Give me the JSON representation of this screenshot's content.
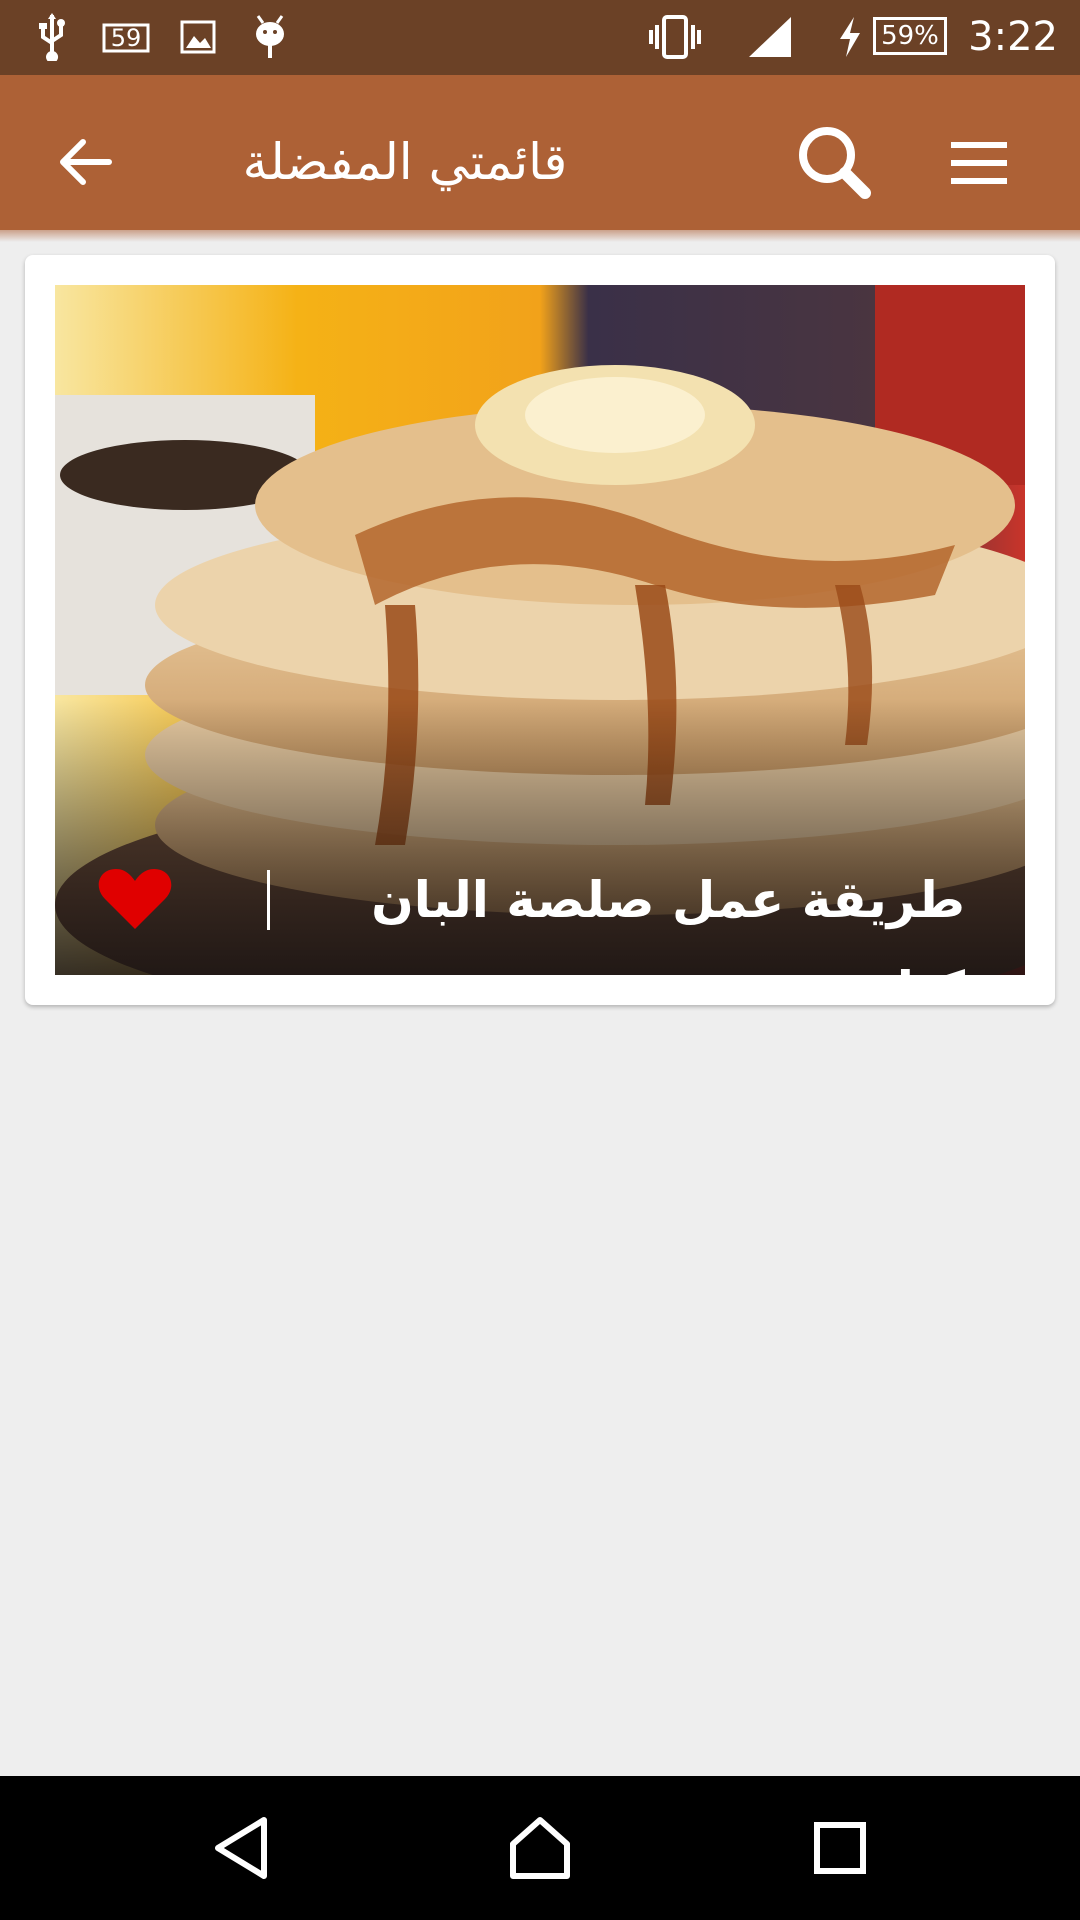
{
  "status_bar": {
    "time": "3:22",
    "battery_percent": "59%",
    "notification_count": "59",
    "icons": [
      "usb-icon",
      "notification-badge-icon",
      "image-icon",
      "android-debug-icon",
      "vibrate-icon",
      "signal-icon",
      "charging-icon",
      "battery-icon"
    ]
  },
  "app_bar": {
    "title": "قائمتي المفضلة",
    "back_icon": "arrow-left-icon",
    "search_icon": "search-icon",
    "menu_icon": "hamburger-menu-icon",
    "color": "#ad6136"
  },
  "favorites": [
    {
      "title": "طريقة عمل صلصة البان كيك",
      "image": "pancakes-with-syrup",
      "favorite": true,
      "heart_color": "#e00000"
    }
  ],
  "nav_bar": {
    "icons": [
      "back-triangle-icon",
      "home-icon",
      "recents-square-icon"
    ]
  },
  "colors": {
    "status_bar": "#6b4126",
    "background": "#eeeeee"
  }
}
